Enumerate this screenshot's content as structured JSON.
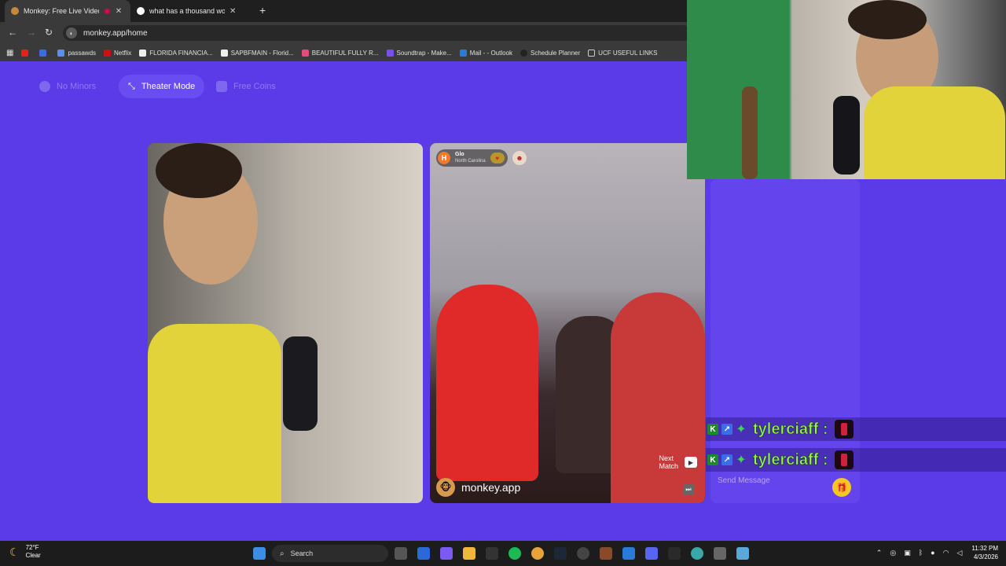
{
  "browser": {
    "tabs": [
      {
        "title": "Monkey: Free Live Video Ch",
        "active": true
      },
      {
        "title": "what has a thousand words bu",
        "active": false
      }
    ],
    "new_tab": "+",
    "url": "monkey.app/home",
    "bookmarks": [
      "passawds",
      "Netflix",
      "FLORIDA FINANCIA...",
      "SAPBFMAIN - Florid...",
      "BEAUTIFUL FULLY R...",
      "Soundtrap - Make...",
      "Mail - - Outlook",
      "Schedule Planner",
      "UCF USEFUL LINKS"
    ]
  },
  "page": {
    "top_buttons": {
      "no_minors": "No Minors",
      "theater_mode": "Theater Mode",
      "free_coins": "Free Coins"
    },
    "match": {
      "avatar_letter": "H",
      "name": "Glo",
      "location": "North Carolina"
    },
    "watermark": "monkey.app",
    "next_match": {
      "line1": "Next",
      "line2": "Match"
    }
  },
  "chat": {
    "messages": [
      {
        "user": "tylerciaff :"
      },
      {
        "user": "tylerciaff :"
      }
    ],
    "input_placeholder": "Send Message"
  },
  "taskbar": {
    "weather": {
      "temp": "72°F",
      "condition": "Clear"
    },
    "search_label": "Search",
    "clock": {
      "time": "11:32 PM",
      "date": "4/3/2026"
    }
  },
  "colors": {
    "page_bg": "#5b3be8",
    "chat_user": "#9df05a",
    "accent": "#6a4df0"
  }
}
